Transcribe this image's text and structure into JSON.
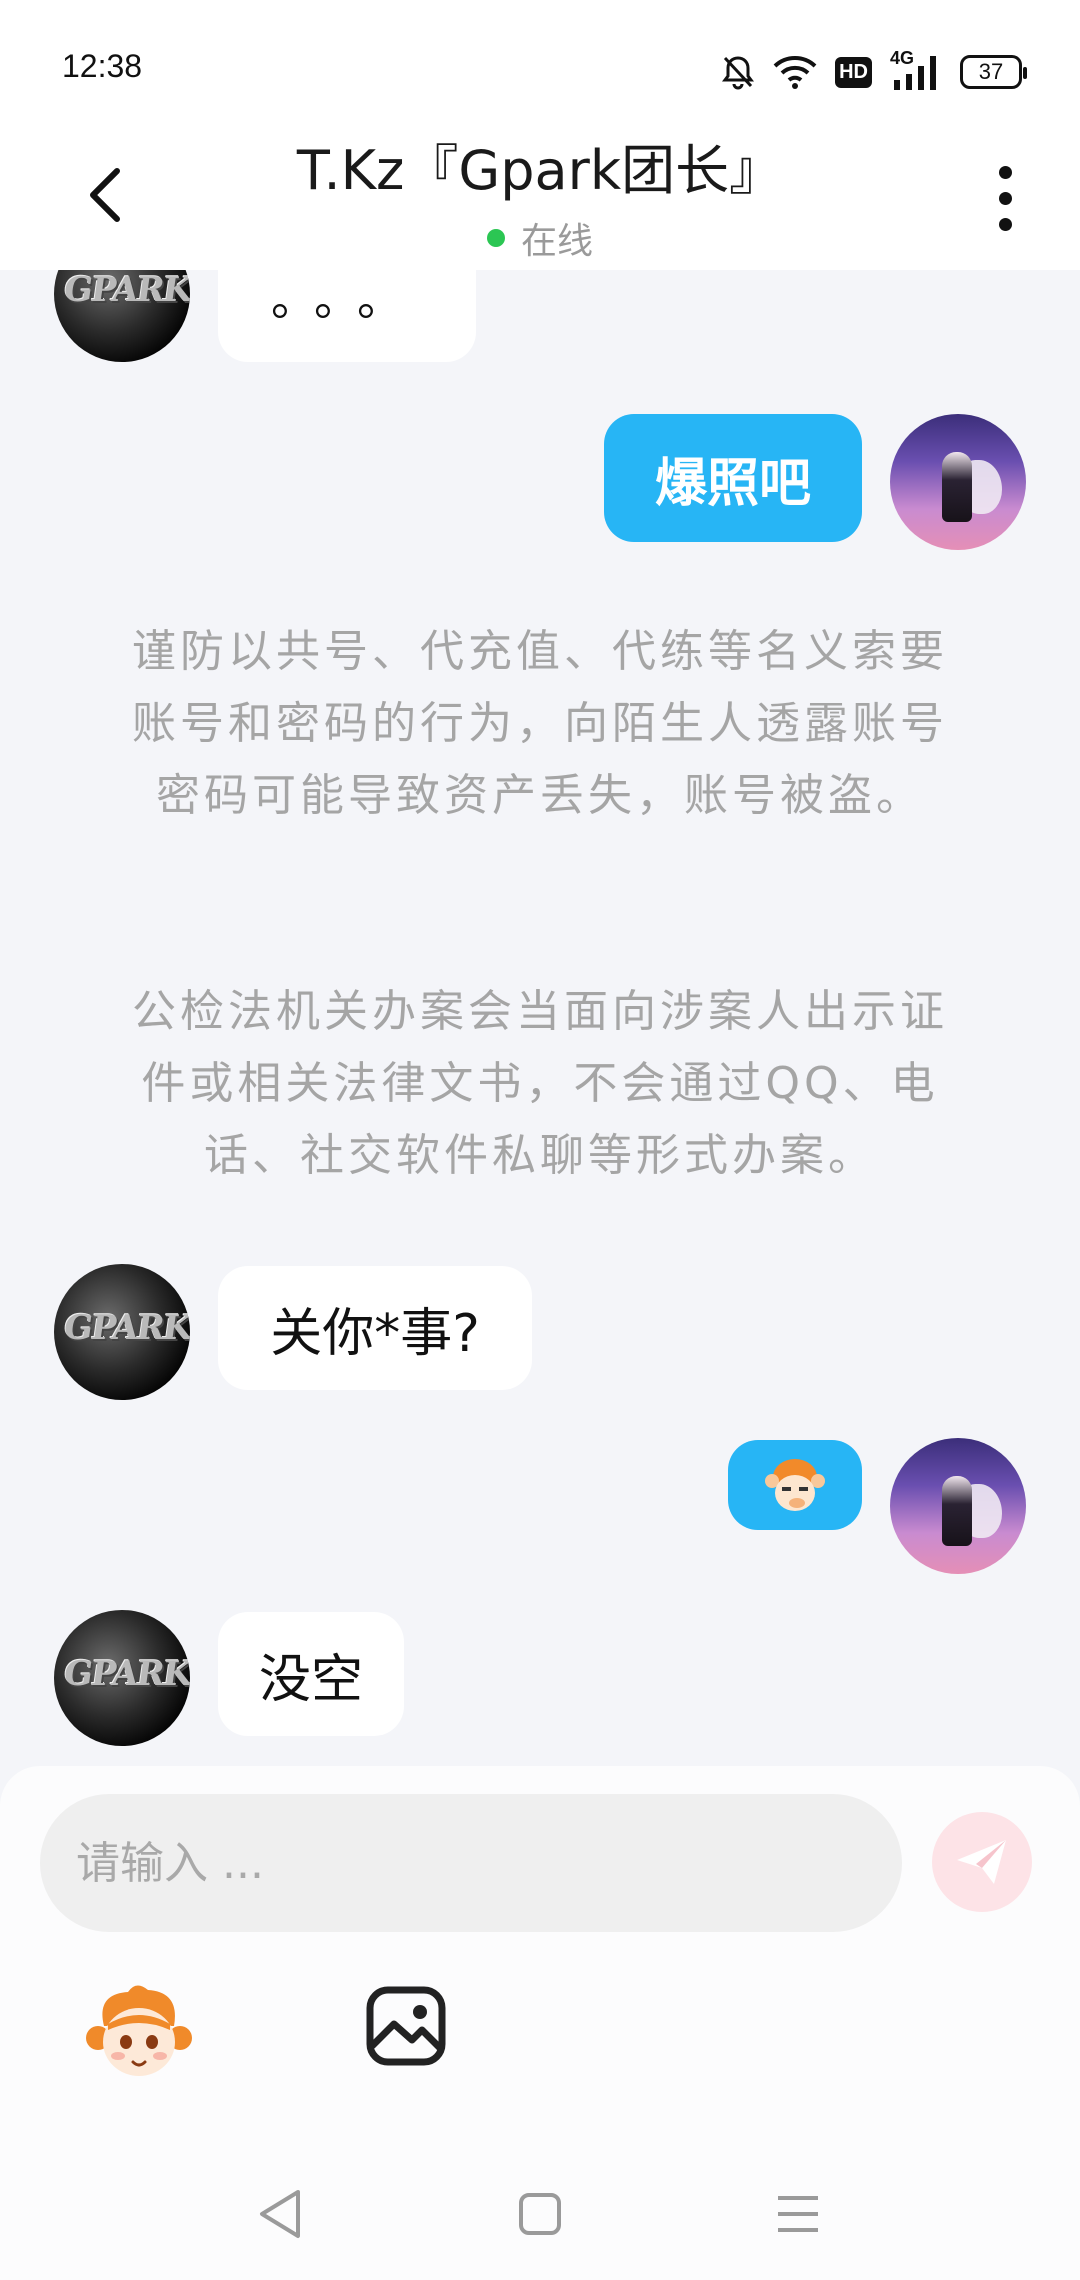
{
  "status_bar": {
    "time": "12:38",
    "hd_badge": "HD",
    "network": "4G",
    "battery": "37",
    "icons": [
      "bell-off-icon",
      "wifi-icon",
      "hd-icon",
      "signal-icon",
      "battery-icon"
    ]
  },
  "header": {
    "back_icon": "chevron-left-icon",
    "title": "T.Kz『Gpark团长』",
    "status": "在线",
    "status_color": "#2bc653",
    "more_icon": "more-vertical-icon"
  },
  "messages": [
    {
      "sender": "peer",
      "type": "text",
      "text": "。。。"
    },
    {
      "sender": "self",
      "type": "text",
      "text": "爆照吧"
    },
    {
      "sender": "peer",
      "type": "text",
      "text": "关你*事?"
    },
    {
      "sender": "self",
      "type": "sticker",
      "sticker": "monkey-sticker-icon"
    },
    {
      "sender": "peer",
      "type": "text",
      "text": "没空"
    }
  ],
  "peer_avatar_text": "GPARK",
  "notice": {
    "paragraph1": "谨防以共号、代充值、代练等名义索要账号和密码的行为，向陌生人透露账号密码可能导致资产丢失，账号被盗。",
    "paragraph2": "公检法机关办案会当面向涉案人出示证件或相关法律文书，不会通过QQ、电话、社交软件私聊等形式办案。"
  },
  "composer": {
    "placeholder": "请输入 ...",
    "send_icon": "send-icon",
    "emoji_icon": "emoji-icon",
    "image_icon": "image-icon"
  },
  "navigation": [
    "back-triangle-icon",
    "home-square-icon",
    "menu-lines-icon"
  ],
  "colors": {
    "self_bubble": "#27b5f5",
    "peer_bubble": "#ffffff",
    "background": "#f4f5f9",
    "send_button": "#fde3e7"
  }
}
